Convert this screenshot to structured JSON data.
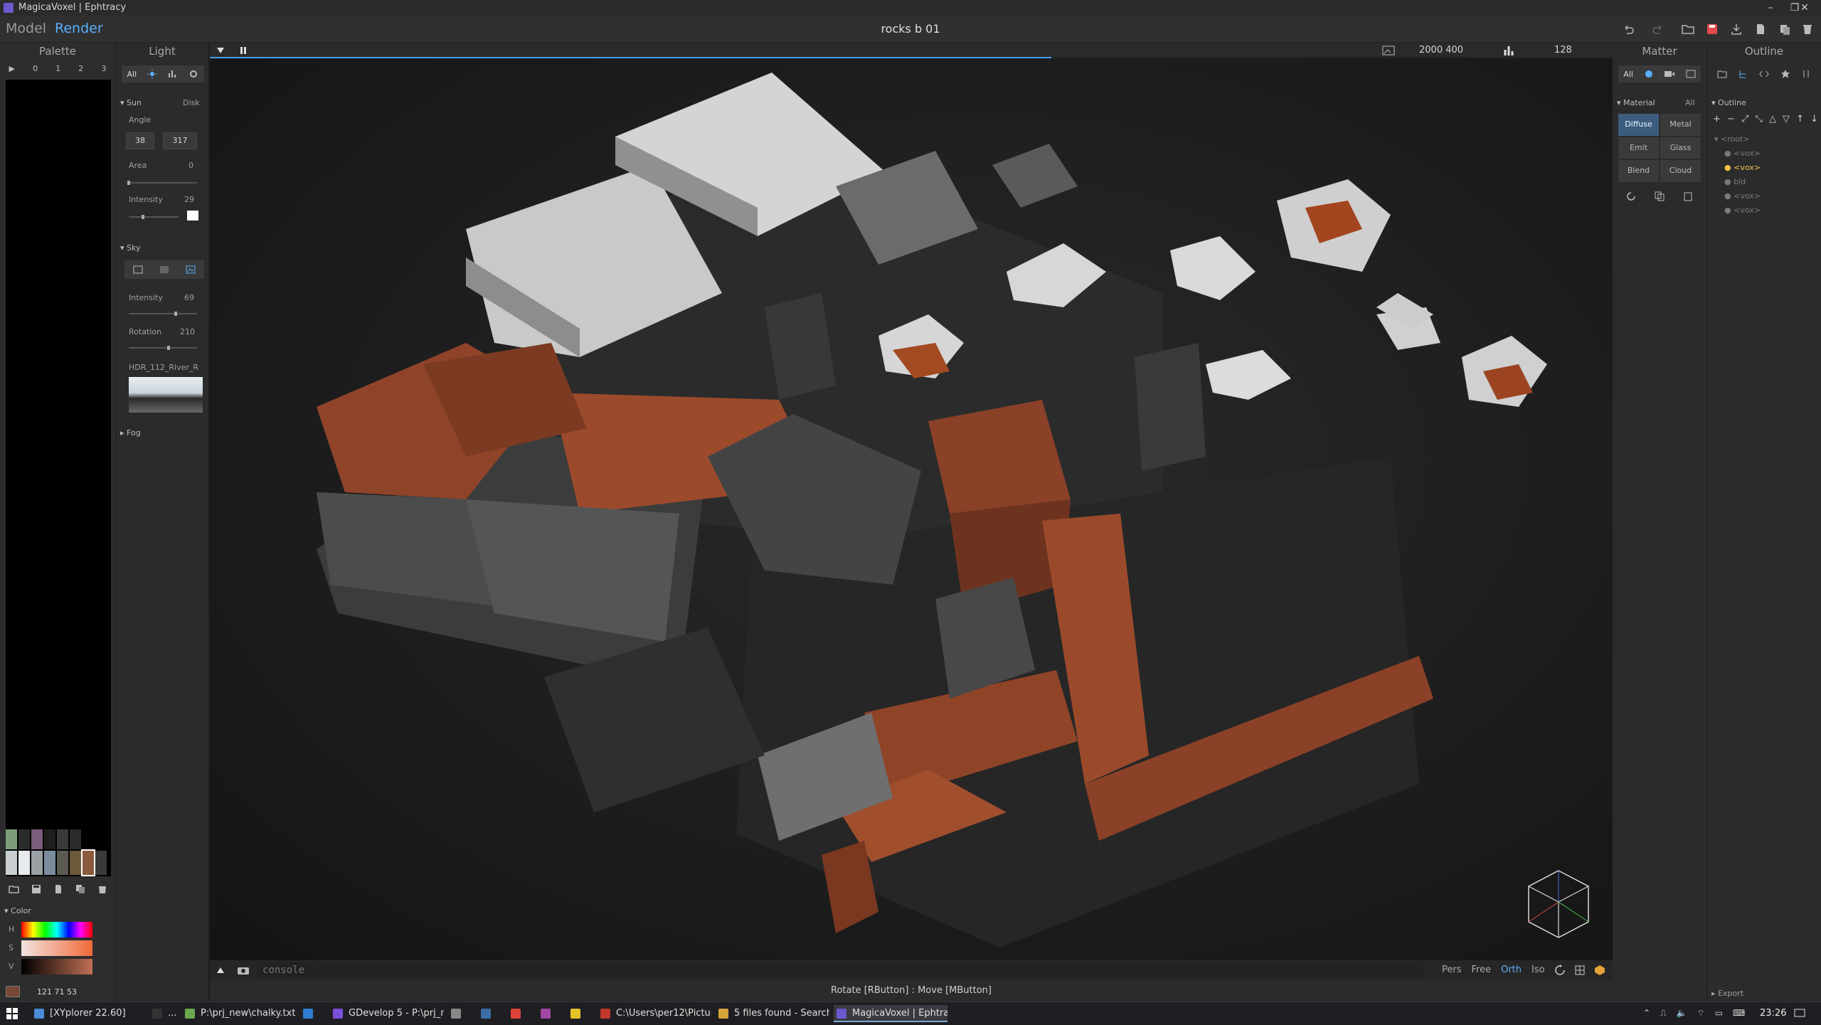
{
  "window": {
    "title": "MagicaVoxel | Ephtracy",
    "minimize": "–",
    "maximize": "❐",
    "close": "✕"
  },
  "menubar": {
    "model_tab": "Model",
    "render_tab": "Render",
    "document_title": "rocks b 01"
  },
  "palette": {
    "header": "Palette",
    "pages": [
      "▶",
      "0",
      "1",
      "2",
      "3"
    ],
    "swatches_row1": [
      "#7d9b7a",
      "#2b2b2b",
      "#7a5d7a",
      "#1e1e1e",
      "#3a3a3a",
      "#2a2a2a"
    ],
    "swatches_row2": [
      "#c9cfd1",
      "#e7eaec",
      "#9aa0a4",
      "#7b8c9c",
      "#5b5b52",
      "#6b5a3a",
      "#8b5a3e",
      "#3a3a3a"
    ],
    "color_section": "Color",
    "h_label": "H",
    "s_label": "S",
    "v_label": "V",
    "rgb_value": "121  71  53",
    "selected_color": "#794735"
  },
  "light": {
    "header": "Light",
    "tab_all": "All",
    "sun_section": "Sun",
    "disk_label": "Disk",
    "angle_label": "Angle",
    "angle_1": "38",
    "angle_2": "317",
    "area_label": "Area",
    "area_value": "0",
    "area_level": 0.0,
    "intensity_label": "Intensity",
    "intensity_value": "29",
    "intensity_level": 0.29,
    "sky_section": "Sky",
    "sky_intensity_label": "Intensity",
    "sky_intensity_value": "69",
    "sky_intensity_level": 0.69,
    "rotation_label": "Rotation",
    "rotation_value": "210",
    "rotation_level": 0.58,
    "hdr_name": "HDR_112_River_R",
    "fog_section": "Fog"
  },
  "render_bar": {
    "resolution": "2000  400",
    "samples": "128",
    "progress": 0.6
  },
  "console": {
    "placeholder": "console",
    "camera_modes": [
      "Pers",
      "Free",
      "Orth",
      "Iso"
    ],
    "active_mode": "Orth"
  },
  "status": {
    "hint": "Rotate [RButton] : Move [MButton]"
  },
  "matter": {
    "header": "Matter",
    "tab_all": "All",
    "material_section": "Material",
    "material_all": "All",
    "materials": [
      "Diffuse",
      "Metal",
      "Emit",
      "Glass",
      "Blend",
      "Cloud"
    ],
    "active_material": "Diffuse"
  },
  "outline": {
    "header": "Outline",
    "section": "Outline",
    "rows": [
      "<root>",
      "<vox>",
      "<vox>",
      "bld",
      "<vox>",
      "<vox>"
    ],
    "selected_index": 2,
    "export_label": "Export"
  },
  "taskbar": {
    "items": [
      {
        "label": "[XYplorer 22.60]",
        "color": "#4b8bd8"
      },
      {
        "label": "...",
        "color": "#333"
      },
      {
        "label": "P:\\prj_new\\chalky.txt ...",
        "color": "#6aa84f"
      },
      {
        "label": "",
        "color": "#2f7dd3"
      },
      {
        "label": "GDevelop 5 - P:\\prj_n...",
        "color": "#7a4fd8"
      },
      {
        "label": "",
        "color": "#888"
      },
      {
        "label": "",
        "color": "#3a6ea5"
      },
      {
        "label": "",
        "color": "#db4437"
      },
      {
        "label": "",
        "color": "#a349a4"
      },
      {
        "label": "",
        "color": "#e6c229"
      },
      {
        "label": "C:\\Users\\per12\\Pictur...",
        "color": "#c0392b"
      },
      {
        "label": "5 files found - Search:...",
        "color": "#d6a23a"
      },
      {
        "label": "MagicaVoxel | Ephtracy",
        "color": "#6a5acd"
      }
    ],
    "clock": "23:26",
    "accent": "#7aa7d8"
  }
}
